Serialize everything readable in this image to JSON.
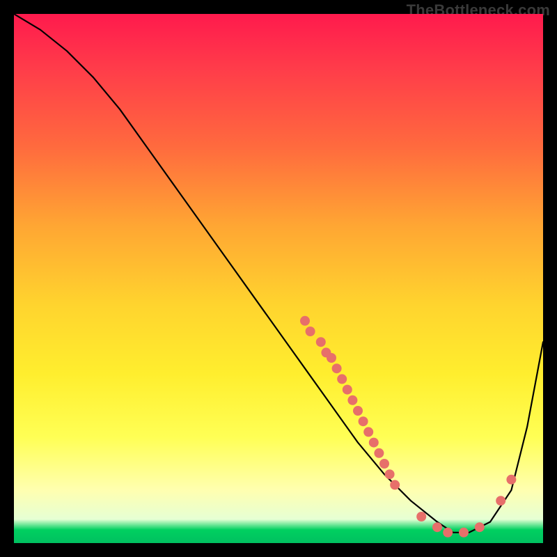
{
  "watermark": "TheBottleneck.com",
  "chart_data": {
    "type": "line",
    "title": "",
    "xlabel": "",
    "ylabel": "",
    "xlim": [
      0,
      100
    ],
    "ylim": [
      0,
      100
    ],
    "gradient_bands": [
      {
        "name": "red",
        "from": 100,
        "to": 70
      },
      {
        "name": "orange",
        "from": 70,
        "to": 40
      },
      {
        "name": "yellow",
        "from": 40,
        "to": 10
      },
      {
        "name": "green",
        "from": 10,
        "to": 0
      }
    ],
    "series": [
      {
        "name": "bottleneck-curve",
        "x": [
          0,
          5,
          10,
          15,
          20,
          25,
          30,
          35,
          40,
          45,
          50,
          55,
          60,
          65,
          70,
          75,
          80,
          83,
          86,
          90,
          94,
          97,
          100
        ],
        "y": [
          100,
          97,
          93,
          88,
          82,
          75,
          68,
          61,
          54,
          47,
          40,
          33,
          26,
          19,
          13,
          8,
          4,
          2,
          2,
          4,
          10,
          22,
          38
        ]
      }
    ],
    "markers": [
      {
        "x": 55,
        "y": 42
      },
      {
        "x": 56,
        "y": 40
      },
      {
        "x": 58,
        "y": 38
      },
      {
        "x": 59,
        "y": 36
      },
      {
        "x": 60,
        "y": 35
      },
      {
        "x": 61,
        "y": 33
      },
      {
        "x": 62,
        "y": 31
      },
      {
        "x": 63,
        "y": 29
      },
      {
        "x": 64,
        "y": 27
      },
      {
        "x": 65,
        "y": 25
      },
      {
        "x": 66,
        "y": 23
      },
      {
        "x": 67,
        "y": 21
      },
      {
        "x": 68,
        "y": 19
      },
      {
        "x": 69,
        "y": 17
      },
      {
        "x": 70,
        "y": 15
      },
      {
        "x": 71,
        "y": 13
      },
      {
        "x": 72,
        "y": 11
      },
      {
        "x": 77,
        "y": 5
      },
      {
        "x": 80,
        "y": 3
      },
      {
        "x": 82,
        "y": 2
      },
      {
        "x": 85,
        "y": 2
      },
      {
        "x": 88,
        "y": 3
      },
      {
        "x": 92,
        "y": 8
      },
      {
        "x": 94,
        "y": 12
      }
    ],
    "marker_style": {
      "color": "#e76f6a",
      "radius_px": 7
    }
  }
}
